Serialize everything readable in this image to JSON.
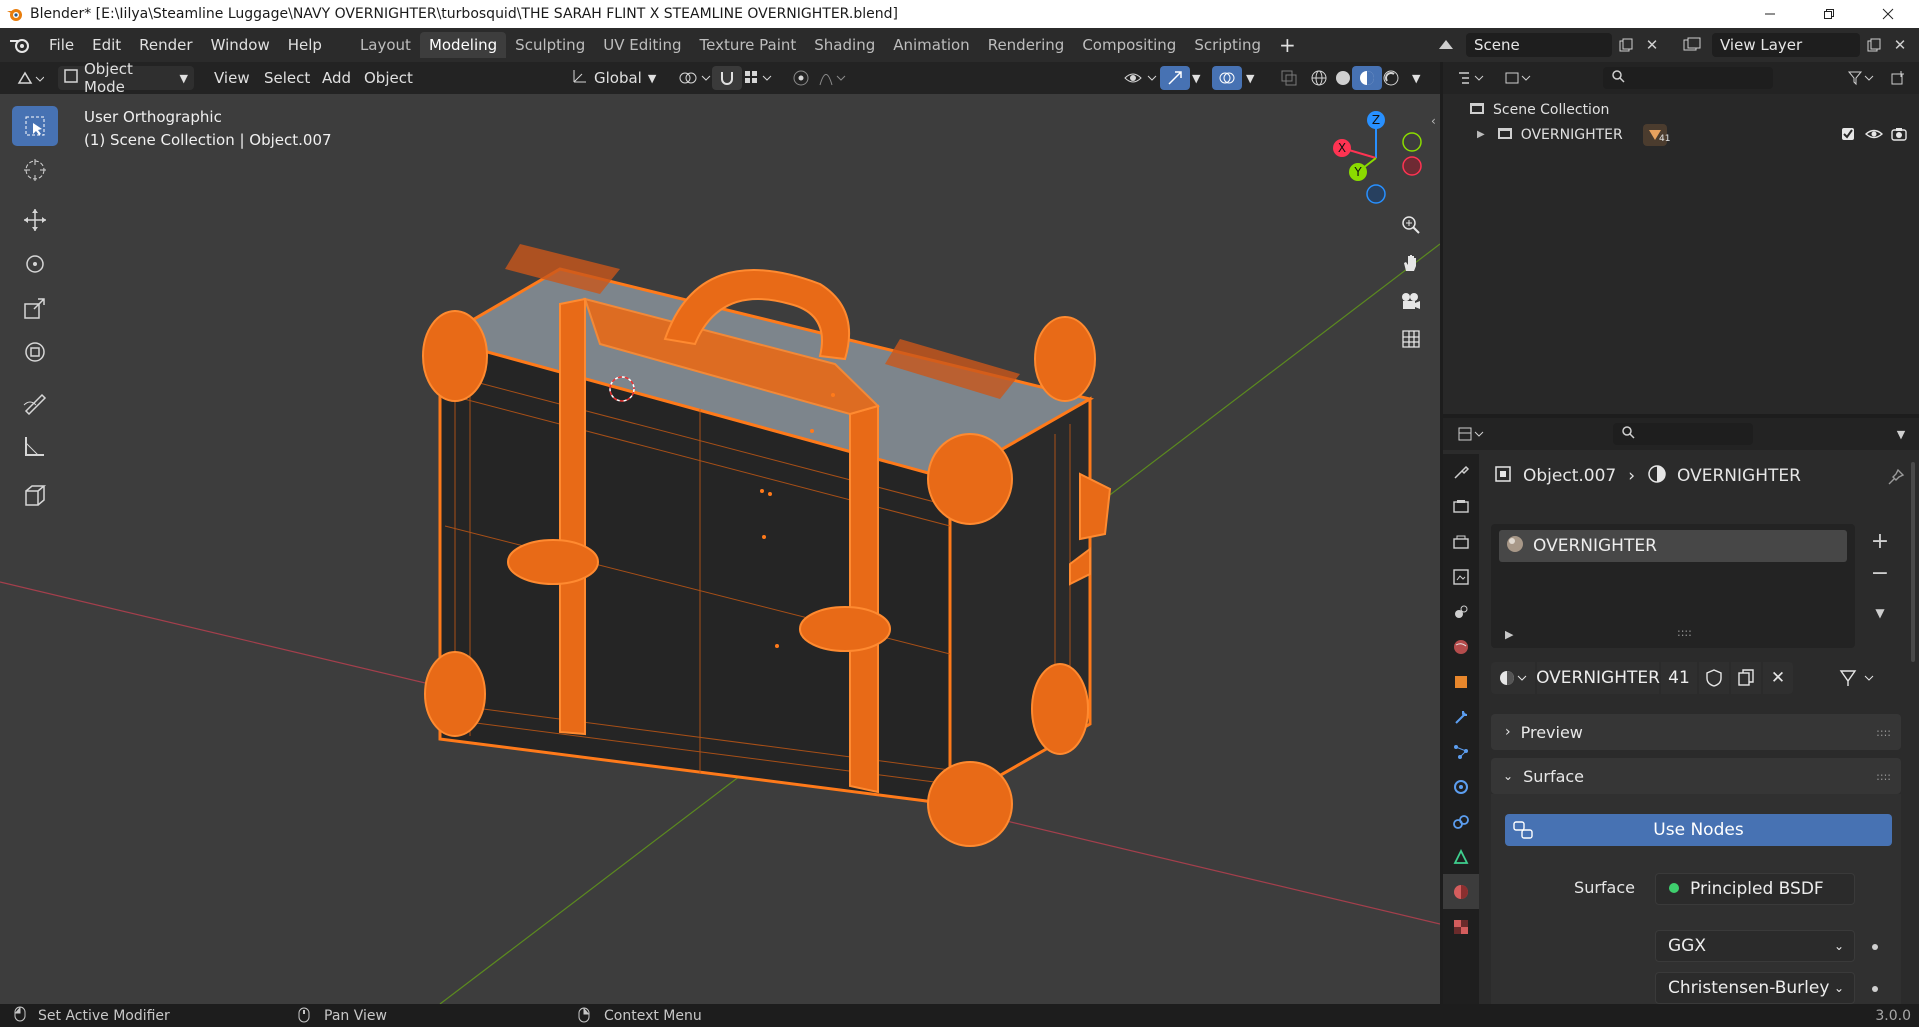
{
  "titlebar": {
    "text": "Blender* [E:\\Iilya\\Steamline Luggage\\NAVY OVERNIGHTER\\turbosquid\\THE SARAH FLINT X STEAMLINE OVERNIGHTER.blend]"
  },
  "menu": [
    "File",
    "Edit",
    "Render",
    "Window",
    "Help"
  ],
  "workspaces": [
    "Layout",
    "Modeling",
    "Sculpting",
    "UV Editing",
    "Texture Paint",
    "Shading",
    "Animation",
    "Rendering",
    "Compositing",
    "Scripting"
  ],
  "scene": {
    "name": "Scene",
    "view_layer": "View Layer"
  },
  "viewport_header": {
    "mode": "Object Mode",
    "menus": [
      "View",
      "Select",
      "Add",
      "Object"
    ],
    "orientation": "Global"
  },
  "viewport": {
    "view_name": "User Orthographic",
    "collection_info": "(1) Scene Collection | Object.007"
  },
  "gizmo": {
    "x": "X",
    "y": "Y",
    "z": "Z"
  },
  "outliner": {
    "root": "Scene Collection",
    "items": [
      {
        "name": "OVERNIGHTER",
        "badge": "41"
      }
    ]
  },
  "properties": {
    "object": "Object.007",
    "material": "OVERNIGHTER",
    "slot": "OVERNIGHTER",
    "mat_name": "OVERNIGHTER",
    "users": "41",
    "sections": {
      "preview": "Preview",
      "surface": "Surface"
    },
    "use_nodes": "Use Nodes",
    "surface_label": "Surface",
    "surface_value": "Principled BSDF",
    "distribution": "GGX",
    "subsurface": "Christensen-Burley"
  },
  "statusbar": {
    "left": "Set Active Modifier",
    "middle": "Pan View",
    "right": "Context Menu",
    "version": "3.0.0"
  },
  "colors": {
    "accent": "#4772b3",
    "selection": "#ff7a1a",
    "x_axis": "#ff3352",
    "y_axis": "#8bdc00",
    "z_axis": "#2890ff"
  }
}
